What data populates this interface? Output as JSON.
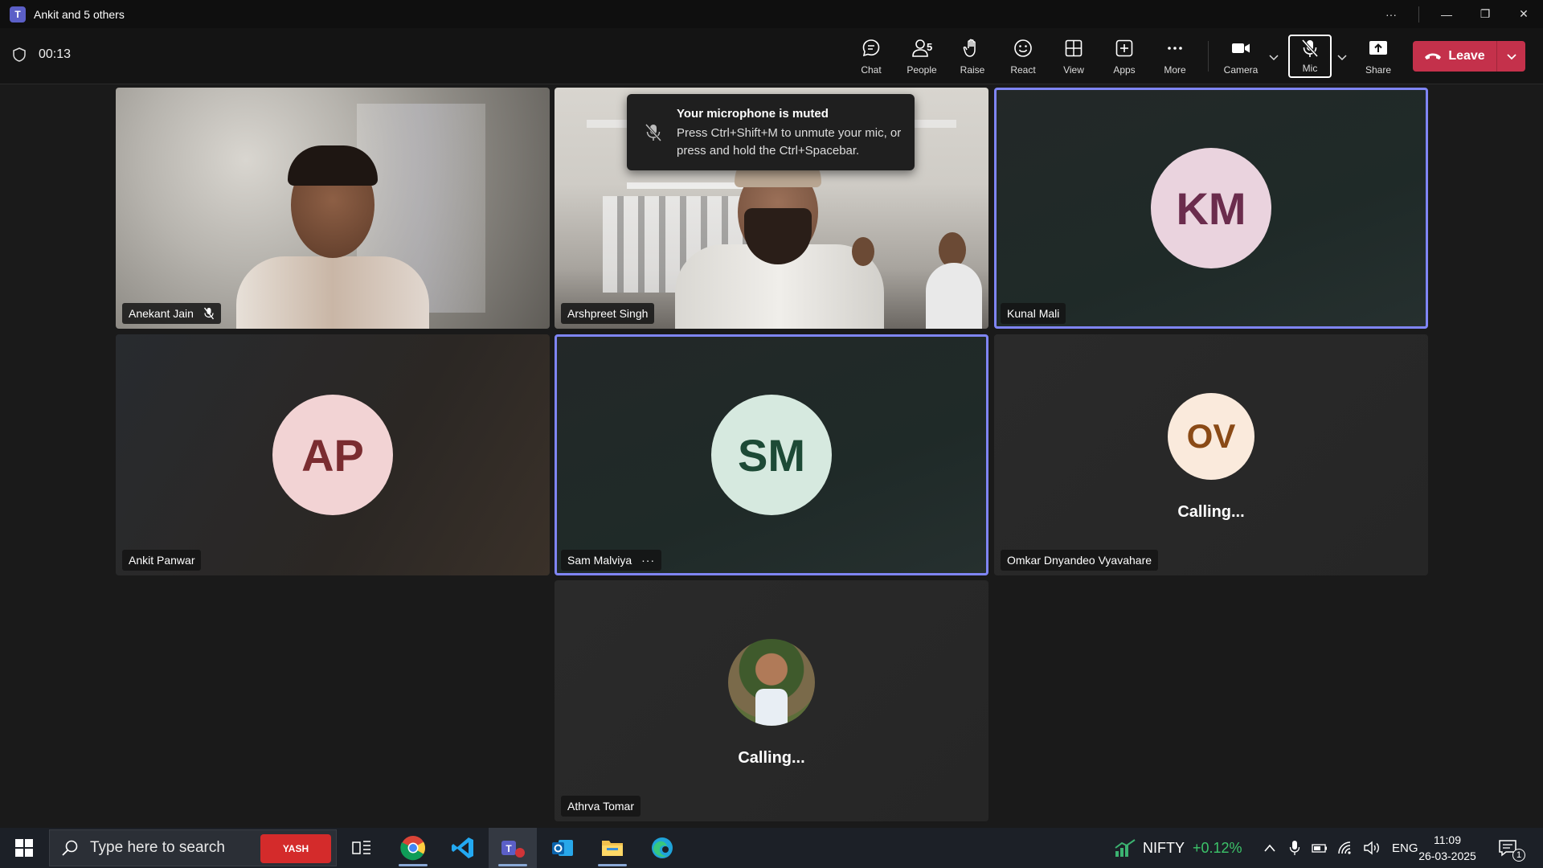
{
  "window": {
    "title": "Ankit and 5 others"
  },
  "meeting": {
    "timer": "00:13",
    "toolbar": {
      "chat": "Chat",
      "people": "People",
      "people_count": "5",
      "raise": "Raise",
      "react": "React",
      "view": "View",
      "apps": "Apps",
      "more": "More",
      "camera": "Camera",
      "mic": "Mic",
      "share": "Share",
      "leave": "Leave"
    },
    "toast": {
      "title": "Your microphone is muted",
      "body": "Press Ctrl+Shift+M to unmute your mic, or press and hold the Ctrl+Spacebar."
    },
    "participants": [
      {
        "name": "Anekant Jain"
      },
      {
        "name": "Arshpreet Singh"
      },
      {
        "name": "Kunal Mali",
        "initials": "KM"
      },
      {
        "name": "Ankit Panwar",
        "initials": "AP"
      },
      {
        "name": "Sam Malviya",
        "initials": "SM",
        "menu": "···"
      },
      {
        "name": "Omkar Dnyandeo Vyavahare",
        "initials": "OV",
        "status": "Calling..."
      },
      {
        "name": "Athrva Tomar",
        "status": "Calling..."
      }
    ],
    "colors": {
      "accent": "#7f85f5",
      "leave": "#c4314b"
    }
  },
  "taskbar": {
    "search_placeholder": "Type here to search",
    "search_badge": "YASH",
    "stock_name": "NIFTY",
    "stock_change": "+0.12%",
    "language": "ENG",
    "time": "11:09",
    "date": "26-03-2025",
    "notifications": "1"
  }
}
